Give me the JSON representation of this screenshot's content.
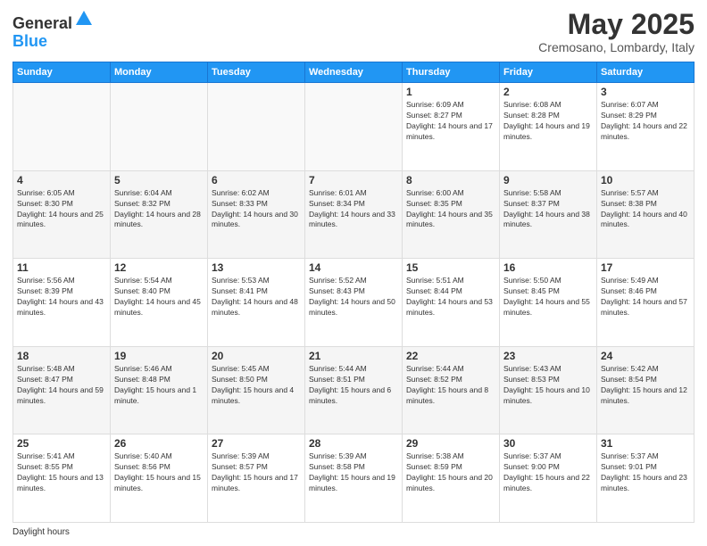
{
  "header": {
    "logo_general": "General",
    "logo_blue": "Blue",
    "month_title": "May 2025",
    "location": "Cremosano, Lombardy, Italy"
  },
  "footer": {
    "daylight_label": "Daylight hours"
  },
  "weekdays": [
    "Sunday",
    "Monday",
    "Tuesday",
    "Wednesday",
    "Thursday",
    "Friday",
    "Saturday"
  ],
  "weeks": [
    [
      {
        "num": "",
        "empty": true
      },
      {
        "num": "",
        "empty": true
      },
      {
        "num": "",
        "empty": true
      },
      {
        "num": "",
        "empty": true
      },
      {
        "num": "1",
        "sunrise": "6:09 AM",
        "sunset": "8:27 PM",
        "daylight": "14 hours and 17 minutes."
      },
      {
        "num": "2",
        "sunrise": "6:08 AM",
        "sunset": "8:28 PM",
        "daylight": "14 hours and 19 minutes."
      },
      {
        "num": "3",
        "sunrise": "6:07 AM",
        "sunset": "8:29 PM",
        "daylight": "14 hours and 22 minutes."
      }
    ],
    [
      {
        "num": "4",
        "sunrise": "6:05 AM",
        "sunset": "8:30 PM",
        "daylight": "14 hours and 25 minutes."
      },
      {
        "num": "5",
        "sunrise": "6:04 AM",
        "sunset": "8:32 PM",
        "daylight": "14 hours and 28 minutes."
      },
      {
        "num": "6",
        "sunrise": "6:02 AM",
        "sunset": "8:33 PM",
        "daylight": "14 hours and 30 minutes."
      },
      {
        "num": "7",
        "sunrise": "6:01 AM",
        "sunset": "8:34 PM",
        "daylight": "14 hours and 33 minutes."
      },
      {
        "num": "8",
        "sunrise": "6:00 AM",
        "sunset": "8:35 PM",
        "daylight": "14 hours and 35 minutes."
      },
      {
        "num": "9",
        "sunrise": "5:58 AM",
        "sunset": "8:37 PM",
        "daylight": "14 hours and 38 minutes."
      },
      {
        "num": "10",
        "sunrise": "5:57 AM",
        "sunset": "8:38 PM",
        "daylight": "14 hours and 40 minutes."
      }
    ],
    [
      {
        "num": "11",
        "sunrise": "5:56 AM",
        "sunset": "8:39 PM",
        "daylight": "14 hours and 43 minutes."
      },
      {
        "num": "12",
        "sunrise": "5:54 AM",
        "sunset": "8:40 PM",
        "daylight": "14 hours and 45 minutes."
      },
      {
        "num": "13",
        "sunrise": "5:53 AM",
        "sunset": "8:41 PM",
        "daylight": "14 hours and 48 minutes."
      },
      {
        "num": "14",
        "sunrise": "5:52 AM",
        "sunset": "8:43 PM",
        "daylight": "14 hours and 50 minutes."
      },
      {
        "num": "15",
        "sunrise": "5:51 AM",
        "sunset": "8:44 PM",
        "daylight": "14 hours and 53 minutes."
      },
      {
        "num": "16",
        "sunrise": "5:50 AM",
        "sunset": "8:45 PM",
        "daylight": "14 hours and 55 minutes."
      },
      {
        "num": "17",
        "sunrise": "5:49 AM",
        "sunset": "8:46 PM",
        "daylight": "14 hours and 57 minutes."
      }
    ],
    [
      {
        "num": "18",
        "sunrise": "5:48 AM",
        "sunset": "8:47 PM",
        "daylight": "14 hours and 59 minutes."
      },
      {
        "num": "19",
        "sunrise": "5:46 AM",
        "sunset": "8:48 PM",
        "daylight": "15 hours and 1 minute."
      },
      {
        "num": "20",
        "sunrise": "5:45 AM",
        "sunset": "8:50 PM",
        "daylight": "15 hours and 4 minutes."
      },
      {
        "num": "21",
        "sunrise": "5:44 AM",
        "sunset": "8:51 PM",
        "daylight": "15 hours and 6 minutes."
      },
      {
        "num": "22",
        "sunrise": "5:44 AM",
        "sunset": "8:52 PM",
        "daylight": "15 hours and 8 minutes."
      },
      {
        "num": "23",
        "sunrise": "5:43 AM",
        "sunset": "8:53 PM",
        "daylight": "15 hours and 10 minutes."
      },
      {
        "num": "24",
        "sunrise": "5:42 AM",
        "sunset": "8:54 PM",
        "daylight": "15 hours and 12 minutes."
      }
    ],
    [
      {
        "num": "25",
        "sunrise": "5:41 AM",
        "sunset": "8:55 PM",
        "daylight": "15 hours and 13 minutes."
      },
      {
        "num": "26",
        "sunrise": "5:40 AM",
        "sunset": "8:56 PM",
        "daylight": "15 hours and 15 minutes."
      },
      {
        "num": "27",
        "sunrise": "5:39 AM",
        "sunset": "8:57 PM",
        "daylight": "15 hours and 17 minutes."
      },
      {
        "num": "28",
        "sunrise": "5:39 AM",
        "sunset": "8:58 PM",
        "daylight": "15 hours and 19 minutes."
      },
      {
        "num": "29",
        "sunrise": "5:38 AM",
        "sunset": "8:59 PM",
        "daylight": "15 hours and 20 minutes."
      },
      {
        "num": "30",
        "sunrise": "5:37 AM",
        "sunset": "9:00 PM",
        "daylight": "15 hours and 22 minutes."
      },
      {
        "num": "31",
        "sunrise": "5:37 AM",
        "sunset": "9:01 PM",
        "daylight": "15 hours and 23 minutes."
      }
    ]
  ]
}
